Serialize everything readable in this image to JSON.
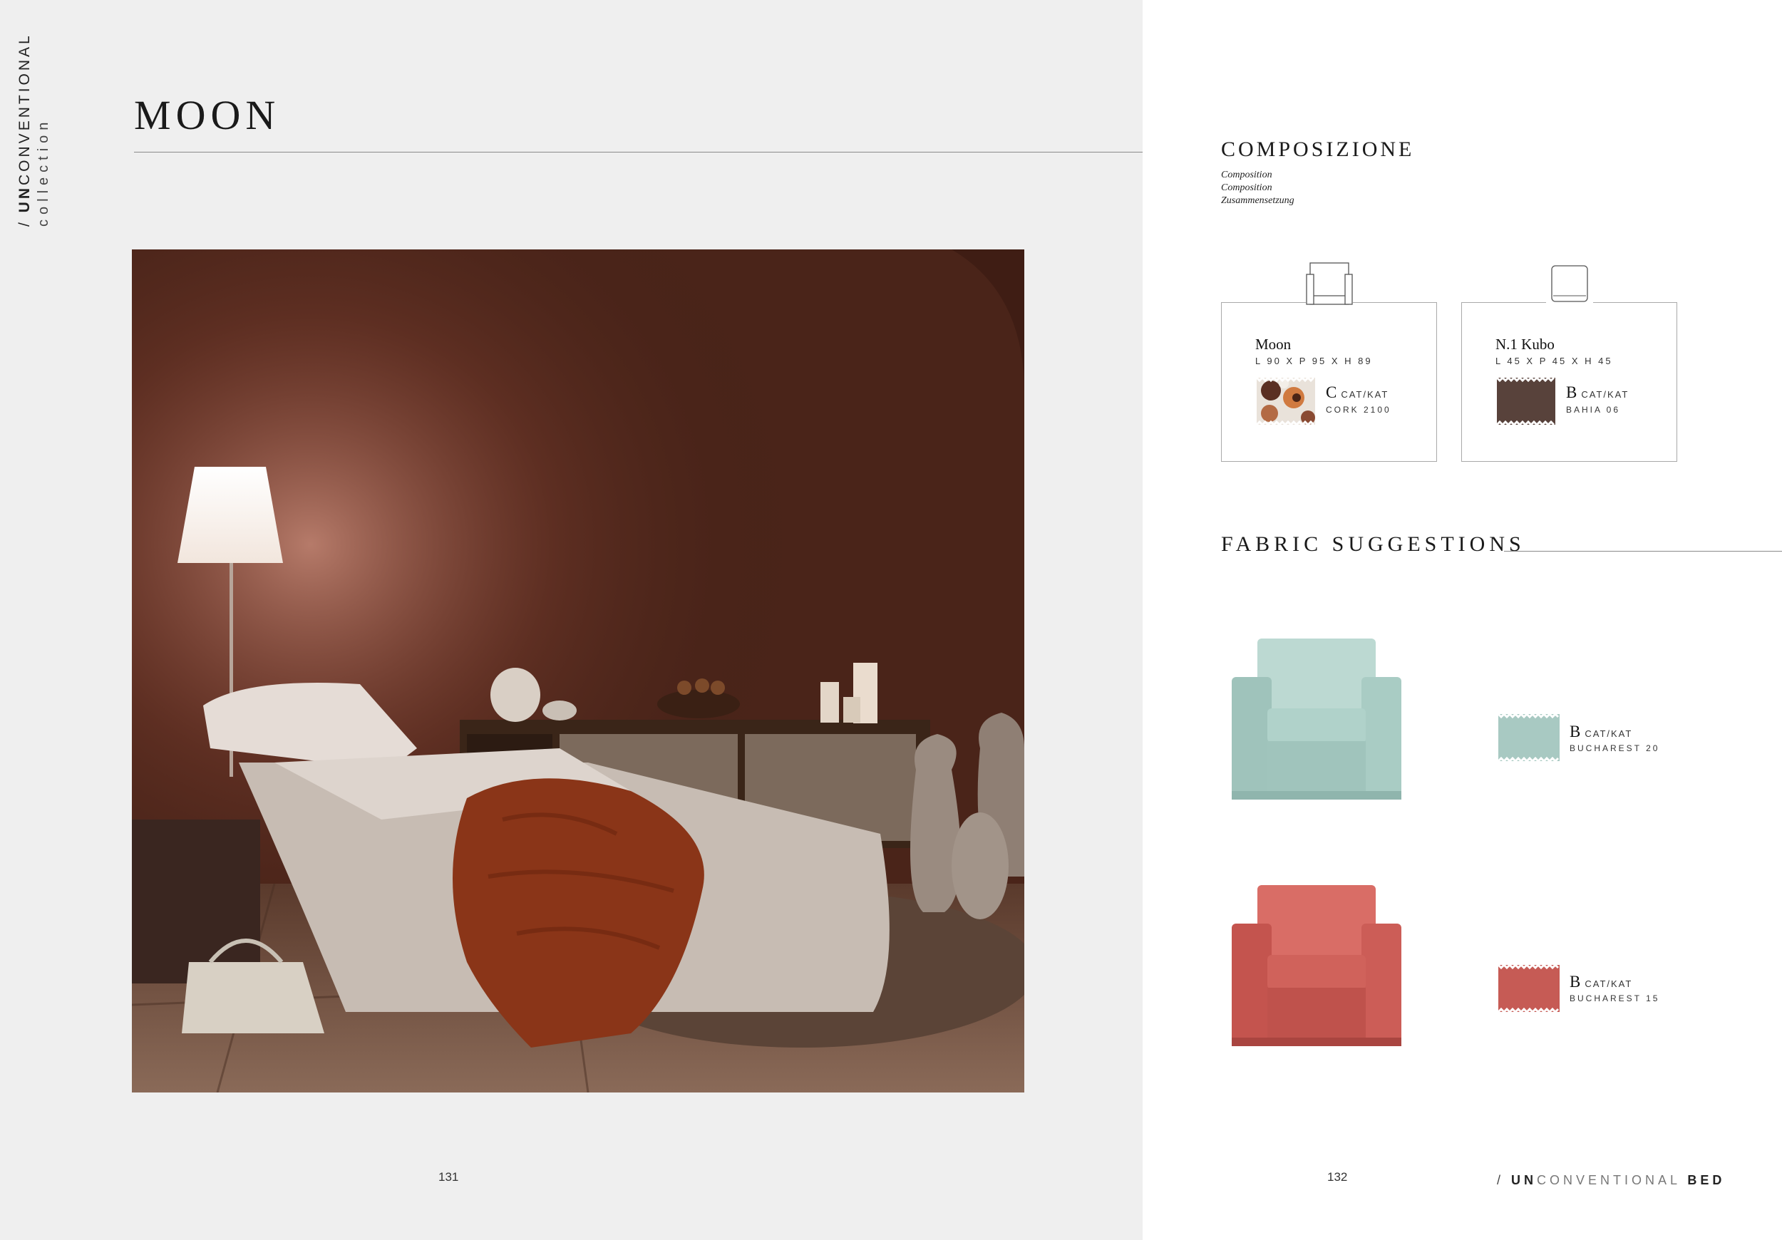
{
  "left_page": {
    "collection_tag": {
      "prefix": "/ ",
      "bold": "UN",
      "rest": "CONVENTIONAL",
      "sub": "collection"
    },
    "title": "MOON",
    "page_number": "131"
  },
  "right_page": {
    "composition": {
      "title": "COMPOSIZIONE",
      "subtitles": [
        "Composition",
        "Composition",
        "Zusammensetzung"
      ],
      "items": [
        {
          "name": "Moon",
          "dims": "L 90 X P 95 X H 89",
          "cat_letter": "C",
          "cat_label": "CAT/KAT",
          "fabric": "CORK 2100",
          "icon": "armchair-icon"
        },
        {
          "name": "N.1 Kubo",
          "dims": "L 45 X P 45 X H 45",
          "cat_letter": "B",
          "cat_label": "CAT/KAT",
          "fabric": "BAHIA 06",
          "icon": "pouf-icon"
        }
      ]
    },
    "fabric_suggestions": {
      "title": "FABRIC SUGGESTIONS",
      "items": [
        {
          "cat_letter": "B",
          "cat_label": "CAT/KAT",
          "fabric": "BUCHAREST 20",
          "color": "#a8c9c2"
        },
        {
          "cat_letter": "B",
          "cat_label": "CAT/KAT",
          "fabric": "BUCHAREST 15",
          "color": "#c65b55"
        }
      ]
    },
    "page_number": "132",
    "footer_tag": {
      "prefix": "/ ",
      "bold": "UN",
      "light": "CONVENTIONAL",
      "suffix": "BED"
    }
  },
  "colors": {
    "left_background": "#efefef",
    "right_background": "#ffffff",
    "rule": "#8a8a8a"
  }
}
